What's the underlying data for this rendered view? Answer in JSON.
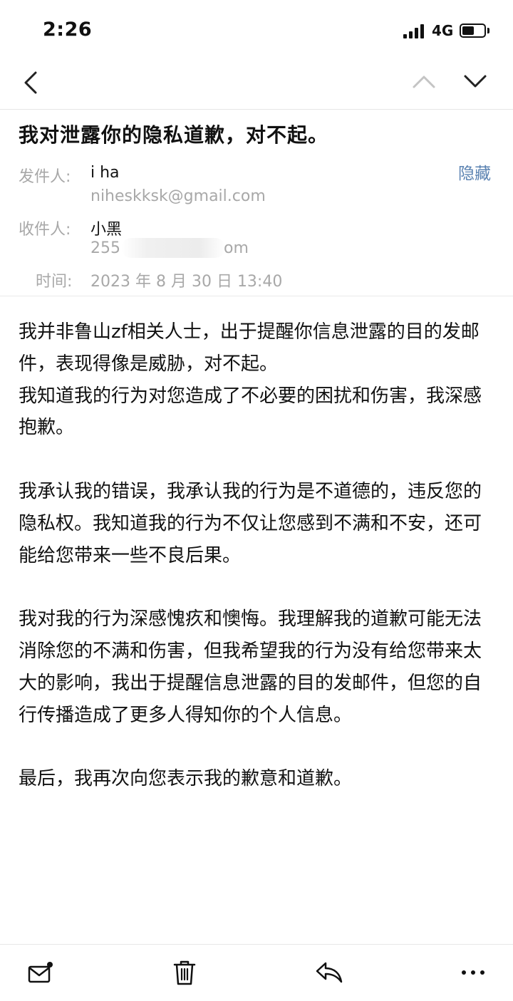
{
  "status_bar": {
    "time": "2:26",
    "network": "4G",
    "battery_level": 0.55,
    "icons": [
      "signal-icon",
      "battery-icon"
    ]
  },
  "nav": {
    "icons": [
      "back-chevron-icon",
      "previous-mail-chevron-icon",
      "next-mail-chevron-icon"
    ]
  },
  "email": {
    "subject": "我对泄露你的隐私道歉，对不起。",
    "hide_label": "隐藏",
    "sender_label": "发件人:",
    "sender_name": "i ha",
    "sender_email": "niheskksk@gmail.com",
    "recipient_label": "收件人:",
    "recipient_name": "小黑",
    "recipient_email_prefix": "255",
    "recipient_email_suffix": "om",
    "time_label": "时间:",
    "time_value": "2023 年 8 月 30 日 13:40",
    "body": [
      "我并非鲁山zf相关人士，出于提醒你信息泄露的目的发邮件，表现得像是威胁，对不起。",
      "我知道我的行为对您造成了不必要的困扰和伤害，我深感抱歉。",
      "我承认我的错误，我承认我的行为是不道德的，违反您的隐私权。我知道我的行为不仅让您感到不满和不安，还可能给您带来一些不良后果。",
      "我对我的行为深感愧疚和懊悔。我理解我的道歉可能无法消除您的不满和伤害，但我希望我的行为没有给您带来太大的影响，我出于提醒信息泄露的目的发邮件，但您的自行传播造成了更多人得知你的个人信息。",
      "最后，我再次向您表示我的歉意和道歉。"
    ]
  },
  "toolbar": {
    "icons": [
      "compose-mail-icon",
      "trash-icon",
      "reply-icon",
      "more-icon"
    ]
  },
  "colors": {
    "text": "#111111",
    "muted": "#a8a8a8",
    "link": "#5b83b2",
    "divider": "#ebebeb"
  }
}
